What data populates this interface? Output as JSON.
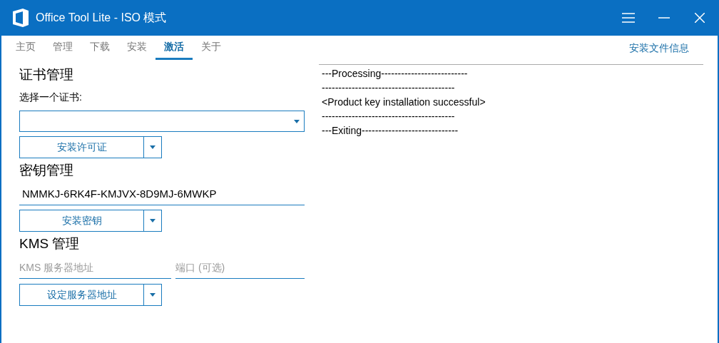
{
  "window": {
    "title": "Office Tool Lite - ISO 模式"
  },
  "tabs": [
    {
      "label": "主页",
      "selected": false
    },
    {
      "label": "管理",
      "selected": false
    },
    {
      "label": "下载",
      "selected": false
    },
    {
      "label": "安装",
      "selected": false
    },
    {
      "label": "激活",
      "selected": true
    },
    {
      "label": "关于",
      "selected": false
    }
  ],
  "top_link": "安装文件信息",
  "certificate": {
    "heading": "证书管理",
    "label": "选择一个证书:",
    "button": "安装许可证"
  },
  "key": {
    "heading": "密钥管理",
    "value": "NMMKJ-6RK4F-KMJVX-8D9MJ-6MWKP",
    "button": "安装密钥"
  },
  "kms": {
    "heading": "KMS 管理",
    "server_placeholder": "KMS 服务器地址",
    "port_placeholder": "端口 (可选)",
    "button": "设定服务器地址"
  },
  "log": "---Processing--------------------------\n----------------------------------------\n<Product key installation successful>\n----------------------------------------\n---Exiting-----------------------------"
}
